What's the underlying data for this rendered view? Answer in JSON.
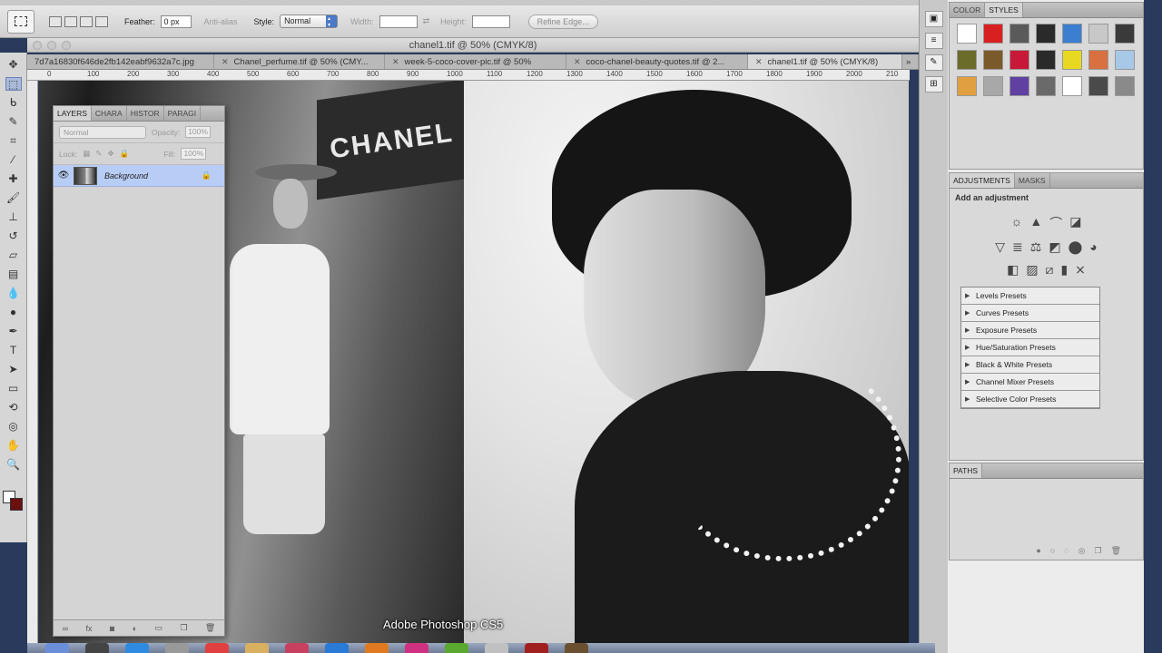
{
  "options_bar": {
    "feather_label": "Feather:",
    "feather_value": "0 px",
    "antialias_label": "Anti-alias",
    "style_label": "Style:",
    "style_value": "Normal",
    "width_label": "Width:",
    "height_label": "Height:",
    "refine_edge_label": "Refine Edge..."
  },
  "document": {
    "title": "chanel1.tif @ 50% (CMYK/8)"
  },
  "tabs": [
    {
      "label": "7d7a16830f646de2fb142eabf9632a7c.jpg"
    },
    {
      "label": "Chanel_perfume.tif @ 50% (CMY..."
    },
    {
      "label": "week-5-coco-cover-pic.tif @ 50%"
    },
    {
      "label": "coco-chanel-beauty-quotes.tif @ 2..."
    },
    {
      "label": "chanel1.tif @ 50% (CMYK/8)"
    }
  ],
  "ruler_ticks": [
    "0",
    "100",
    "200",
    "300",
    "400",
    "500",
    "600",
    "700",
    "800",
    "900",
    "1000",
    "1100",
    "1200",
    "1300",
    "1400",
    "1500",
    "1600",
    "1700",
    "1800",
    "1900",
    "2000",
    "210"
  ],
  "canvas": {
    "sign_text": "CHANEL"
  },
  "layers_panel": {
    "tabs": [
      "LAYERS",
      "CHARA",
      "HISTOR",
      "PARAGI"
    ],
    "blend_mode": "Normal",
    "opacity_label": "Opacity:",
    "opacity_value": "100%",
    "lock_label": "Lock:",
    "fill_label": "Fill:",
    "fill_value": "100%",
    "layer_name": "Background"
  },
  "color_panel": {
    "tabs": [
      "COLOR",
      "STYLES"
    ]
  },
  "adjustments_panel": {
    "tabs": [
      "ADJUSTMENTS",
      "MASKS"
    ],
    "subtitle": "Add an adjustment",
    "presets": [
      "Levels Presets",
      "Curves Presets",
      "Exposure Presets",
      "Hue/Saturation Presets",
      "Black & White Presets",
      "Channel Mixer Presets",
      "Selective Color Presets"
    ]
  },
  "paths_panel": {
    "title": "PATHS"
  },
  "caption": "Adobe Photoshop CS5",
  "style_swatches": [
    "#ffffff",
    "#d82020",
    "#5a5a5a",
    "#2a2a2a",
    "#3a7fd0",
    "#c8c8c8",
    "#3a3a3a",
    "#6b6b2a",
    "#7a5a2a",
    "#c81838",
    "#2a2a2a",
    "#e8d820",
    "#d87040",
    "#a8c8e8",
    "#e0a040",
    "#a8a8a8",
    "#6040a0",
    "#6a6a6a",
    "#ffffff",
    "#4a4a4a",
    "#8a8a8a"
  ]
}
